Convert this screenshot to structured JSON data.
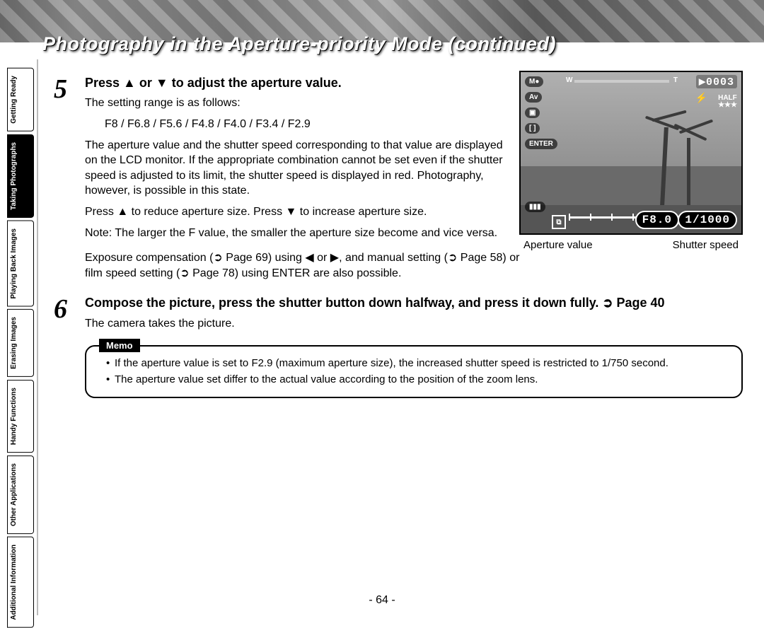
{
  "title": "Photography in the Aperture-priority Mode (continued)",
  "sidebar": {
    "tabs": [
      {
        "label": "Getting\nReady"
      },
      {
        "label": "Taking\nPhotographs"
      },
      {
        "label": "Playing\nBack Images"
      },
      {
        "label": "Erasing\nImages"
      },
      {
        "label": "Handy\nFunctions"
      },
      {
        "label": "Other\nApplications"
      },
      {
        "label": "Additional\nInformation"
      }
    ],
    "active_index": 1
  },
  "step5": {
    "number_alt": "5",
    "heading_prefix": "Press ",
    "heading_mid": " or ",
    "heading_suffix": " to adjust the aperture value.",
    "range_intro": "The setting range is as follows:",
    "range_values": "F8 / F6.8 / F5.6 / F4.8 / F4.0 / F3.4 / F2.9",
    "para1": "The aperture value and the shutter speed corresponding to that value are displayed on the LCD monitor. If the appropriate combination cannot be set even if the shutter speed is adjusted to its limit, the shutter speed is displayed in red. Photography, however, is possible in this state.",
    "para2_pre": "Press ",
    "para2_mid": " to reduce aperture size. Press ",
    "para2_post": " to increase aperture size.",
    "note": "Note: The larger the F value, the smaller the aperture size become and vice versa.",
    "exposure": "Exposure compensation (➲ Page 69) using ◀ or ▶, and manual setting (➲ Page 58) or film speed setting (➲ Page 78) using ENTER are also possible."
  },
  "step6": {
    "number_alt": "6",
    "heading": "Compose the picture, press the shutter button down halfway, and press it down fully. ➲ Page 40",
    "body": "The camera takes the picture."
  },
  "lcd": {
    "mode_icon": "M●",
    "av": "Av",
    "meter": "▣",
    "bracket": "[ ]",
    "enter": "ENTER",
    "counter": "▶0003",
    "half": "HALF",
    "stars": "★★★",
    "zoom_w": "W",
    "zoom_t": "T",
    "ev_icon": "⧉",
    "aperture": "F8.0",
    "shutter": "1/1000",
    "caption_left": "Aperture value",
    "caption_right": "Shutter speed"
  },
  "memo": {
    "label": "Memo",
    "items": [
      "If the aperture value is set to F2.9 (maximum aperture size), the increased shutter speed is restricted to 1/750 second.",
      "The aperture value set differ to the actual value according to the position of the zoom lens."
    ]
  },
  "page_number": "- 64 -"
}
